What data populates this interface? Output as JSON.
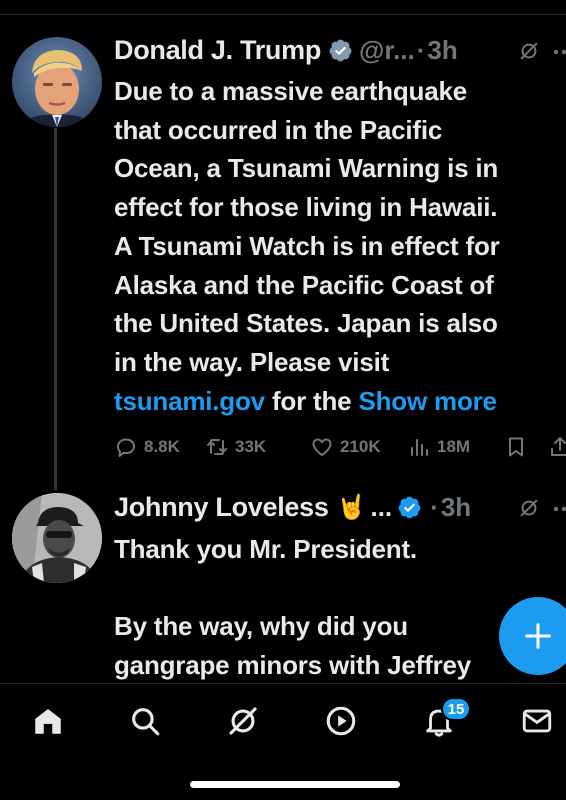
{
  "posts": [
    {
      "author": "Donald J. Trump",
      "handle": "@r...",
      "separator": "·",
      "time": "3h",
      "text_lines": [
        "Due to a massive earthquake",
        "that occurred in the Pacific",
        "Ocean, a Tsunami Warning is in",
        "effect for those living in Hawaii.",
        "A Tsunami Watch is in effect for",
        "Alaska and the Pacific Coast of",
        "the United States. Japan is also",
        "in the way. Please visit"
      ],
      "link": "tsunami.gov",
      "after_link": " for the ",
      "show_more": "Show more",
      "stats": {
        "replies": "8.8K",
        "reposts": "33K",
        "likes": "210K",
        "views": "18M"
      }
    },
    {
      "author": "Johnny Loveless",
      "emoji": "🤘",
      "ellipsis": "...",
      "separator": "·",
      "time": "3h",
      "text_lines": [
        "Thank you Mr. President.",
        "",
        "By the way, why did you",
        "gangrape minors with Jeffrey"
      ]
    }
  ],
  "nav": {
    "icons": [
      "home-icon",
      "search-icon",
      "grok-icon",
      "video-icon",
      "notifications-icon",
      "messages-icon"
    ],
    "notifications_badge": "15"
  },
  "colors": {
    "accent": "#1d9bf0",
    "background": "#000000",
    "text": "#e7e9ea",
    "muted": "#71767b"
  }
}
